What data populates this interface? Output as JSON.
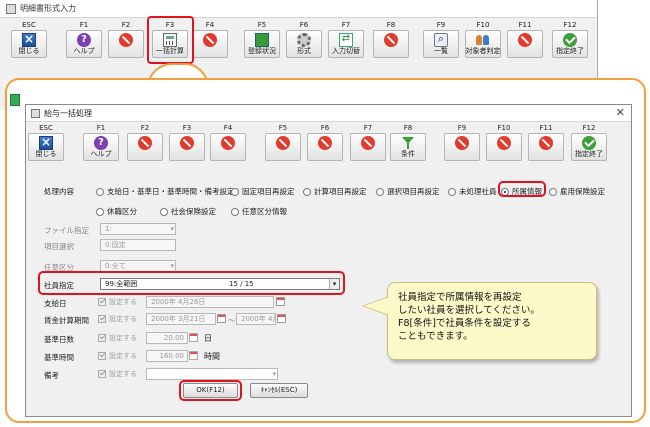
{
  "background_window": {
    "title": "明細書形式入力",
    "toolbar": [
      {
        "key": "ESC",
        "label": "閉じる",
        "icon": "close-icon"
      },
      {
        "key": "F1",
        "label": "ヘルプ",
        "icon": "help-icon"
      },
      {
        "key": "F2",
        "label": "",
        "icon": "disabled-icon"
      },
      {
        "key": "F3",
        "label": "一括計算",
        "icon": "calculator-icon"
      },
      {
        "key": "F4",
        "label": "",
        "icon": "disabled-icon"
      },
      {
        "key": "F5",
        "label": "登録状況",
        "icon": "book-icon"
      },
      {
        "key": "F6",
        "label": "形式",
        "icon": "gear-icon"
      },
      {
        "key": "F7",
        "label": "入力切替",
        "icon": "swap-icon"
      },
      {
        "key": "F8",
        "label": "",
        "icon": "disabled-icon"
      },
      {
        "key": "F9",
        "label": "一覧",
        "icon": "list-icon"
      },
      {
        "key": "F10",
        "label": "対象者判定",
        "icon": "people-icon"
      },
      {
        "key": "F11",
        "label": "",
        "icon": "disabled-icon"
      },
      {
        "key": "F12",
        "label": "指定終了",
        "icon": "check-icon"
      }
    ]
  },
  "dialog": {
    "title": "給与一括処理",
    "toolbar": [
      {
        "key": "ESC",
        "label": "閉じる",
        "icon": "close-icon"
      },
      {
        "key": "F1",
        "label": "ヘルプ",
        "icon": "help-icon"
      },
      {
        "key": "F2",
        "label": "",
        "icon": "disabled-icon"
      },
      {
        "key": "F3",
        "label": "",
        "icon": "disabled-icon"
      },
      {
        "key": "F4",
        "label": "",
        "icon": "disabled-icon"
      },
      {
        "key": "F5",
        "label": "",
        "icon": "disabled-icon"
      },
      {
        "key": "F6",
        "label": "",
        "icon": "disabled-icon"
      },
      {
        "key": "F7",
        "label": "",
        "icon": "disabled-icon"
      },
      {
        "key": "F8",
        "label": "条件",
        "icon": "funnel-icon"
      },
      {
        "key": "F9",
        "label": "",
        "icon": "disabled-icon"
      },
      {
        "key": "F10",
        "label": "",
        "icon": "disabled-icon"
      },
      {
        "key": "F11",
        "label": "",
        "icon": "disabled-icon"
      },
      {
        "key": "F12",
        "label": "指定終了",
        "icon": "check-icon"
      }
    ],
    "process": {
      "label": "処理内容",
      "options": [
        "支給日・基準日・基準時間・備考設定",
        "固定項目再設定",
        "計算項目再設定",
        "選択項目再設定",
        "未処理社員",
        "所属情報",
        "雇用保険設定",
        "休職区分",
        "社会保険設定",
        "任意区分情報"
      ],
      "selected": "所属情報"
    },
    "file_spec": {
      "label": "ファイル指定",
      "value": "1:"
    },
    "item_select": {
      "label": "項目選択",
      "value": "0:固定"
    },
    "optional_class": {
      "label": "任意区分",
      "value": "0:全て"
    },
    "employee_spec": {
      "label": "社員指定",
      "value": "99:全範囲",
      "count": "15 / 15"
    },
    "payday": {
      "label": "支給日",
      "check": "設定する",
      "value": "2000年 4月26日"
    },
    "calc_period": {
      "label": "賃金計算期間",
      "check": "設定する",
      "from": "2000年 3月21日",
      "sep": "～",
      "to": "2000年 4月20日"
    },
    "base_days": {
      "label": "基準日数",
      "check": "設定する",
      "value": "20.00",
      "unit": "日"
    },
    "base_hours": {
      "label": "基準時間",
      "check": "設定する",
      "value": "160.00",
      "unit": "時間"
    },
    "remarks": {
      "label": "備考",
      "check": "設定する",
      "value": ""
    },
    "ok_label": "OK(F12)",
    "cancel_label": "ｷｬﾝｾﾙ(ESC)"
  },
  "callout": {
    "line1": "社員指定で所属情報を再設定",
    "line2": "したい社員を選択してください。",
    "line3": "F8[条件]で社員条件を設定する",
    "line4": "こともできます。"
  },
  "colors": {
    "highlight": "#e0141e",
    "callout_frame": "#f0a040",
    "bubble": "#fdfac9"
  }
}
